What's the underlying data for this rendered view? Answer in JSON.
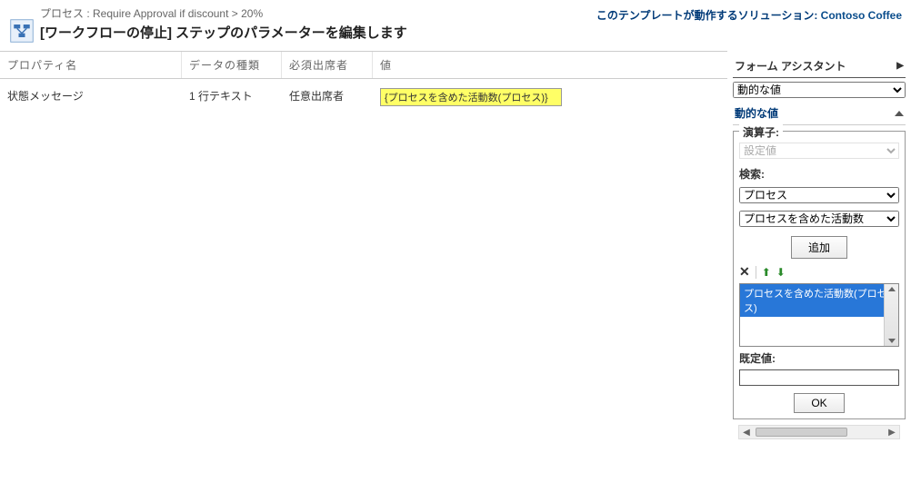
{
  "header": {
    "process_prefix": "プロセス :",
    "process_name": "Require Approval if discount > 20%",
    "title": "[ワークフローの停止] ステップのパラメーターを編集します",
    "solution_prefix": "このテンプレートが動作するソリューション:",
    "solution_name": "Contoso Coffee"
  },
  "grid": {
    "headers": {
      "property": "プロパティ名",
      "type": "データの種類",
      "attendee": "必須出席者",
      "value": "値"
    },
    "row": {
      "property": "状態メッセージ",
      "type": "1 行テキスト",
      "attendee": "任意出席者",
      "value": "{プロセスを含めた活動数(プロセス)}"
    }
  },
  "assistant": {
    "title": "フォーム アシスタント",
    "dynamic_select": "動的な値",
    "dynamic_section": "動的な値",
    "operator": {
      "label": "演算子:",
      "value": "設定値"
    },
    "search": {
      "label": "検索:",
      "process_value": "プロセス",
      "field_value": "プロセスを含めた活動数"
    },
    "add_button": "追加",
    "list_item": "プロセスを含めた活動数(プロセス)",
    "default_label": "既定値:",
    "default_value": "",
    "ok_button": "OK"
  }
}
